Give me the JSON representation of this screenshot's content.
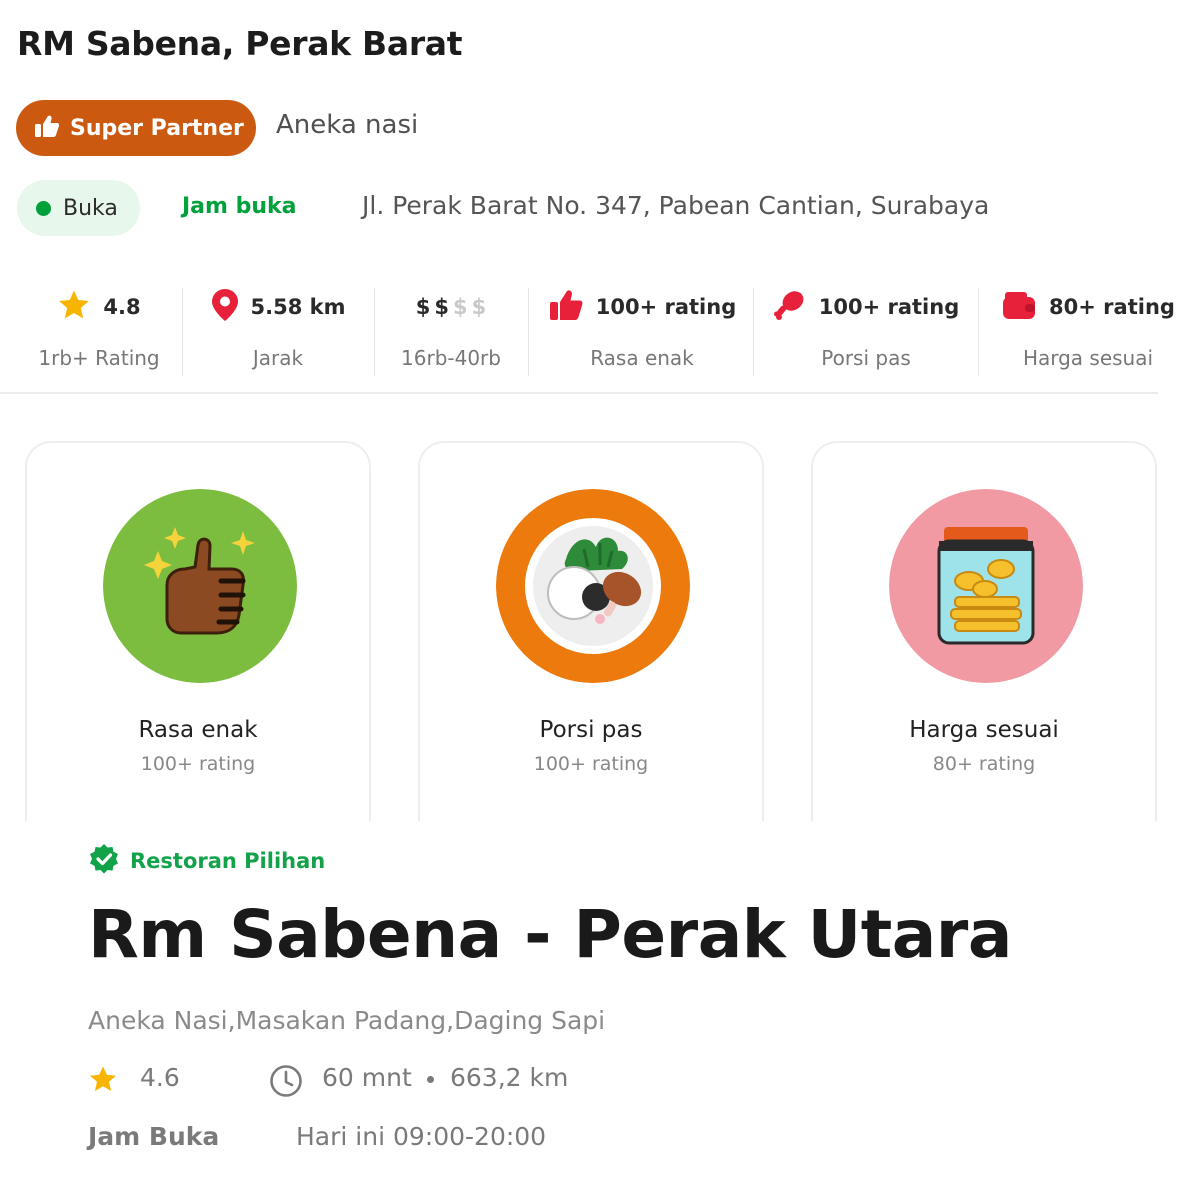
{
  "header": {
    "title": "RM Sabena, Perak Barat",
    "badge_label": "Super Partner",
    "cuisine": "Aneka nasi",
    "status_label": "Buka",
    "hours_link": "Jam buka",
    "address": "Jl. Perak Barat No. 347, Pabean Cantian, Surabaya"
  },
  "stats": [
    {
      "icon": "star-icon",
      "value": "4.8",
      "label": "1rb+ Rating"
    },
    {
      "icon": "location-pin-icon",
      "value": "5.58 km",
      "label": "Jarak"
    },
    {
      "icon": "price-level-icon",
      "value": "$$$$",
      "price_level": 2,
      "label": "16rb-40rb"
    },
    {
      "icon": "thumbs-up-icon",
      "value": "100+ rating",
      "label": "Rasa enak"
    },
    {
      "icon": "drumstick-icon",
      "value": "100+ rating",
      "label": "Porsi pas"
    },
    {
      "icon": "wallet-icon",
      "value": "80+ rating",
      "label": "Harga sesuai"
    }
  ],
  "cards": [
    {
      "icon": "thumbs-up-illustration-icon",
      "title": "Rasa enak",
      "subtitle": "100+ rating",
      "bg": "#7cbd3f"
    },
    {
      "icon": "plate-illustration-icon",
      "title": "Porsi pas",
      "subtitle": "100+ rating",
      "bg": "#ec7a0c"
    },
    {
      "icon": "coin-jar-illustration-icon",
      "title": "Harga sesuai",
      "subtitle": "80+ rating",
      "bg": "#f29aa4"
    }
  ],
  "restaurant": {
    "badge": "Restoran Pilihan",
    "name": "Rm Sabena - Perak Utara",
    "categories": "Aneka Nasi,Masakan Padang,Daging Sapi",
    "rating": "4.6",
    "time": "60 mnt",
    "distance": "663,2 km",
    "hours_label": "Jam Buka",
    "hours_value": "Hari ini  09:00-20:00"
  },
  "colors": {
    "super_partner": "#cb5a10",
    "open_green": "#00a13a",
    "icon_red": "#e8213a",
    "star_yellow": "#f7b500"
  }
}
